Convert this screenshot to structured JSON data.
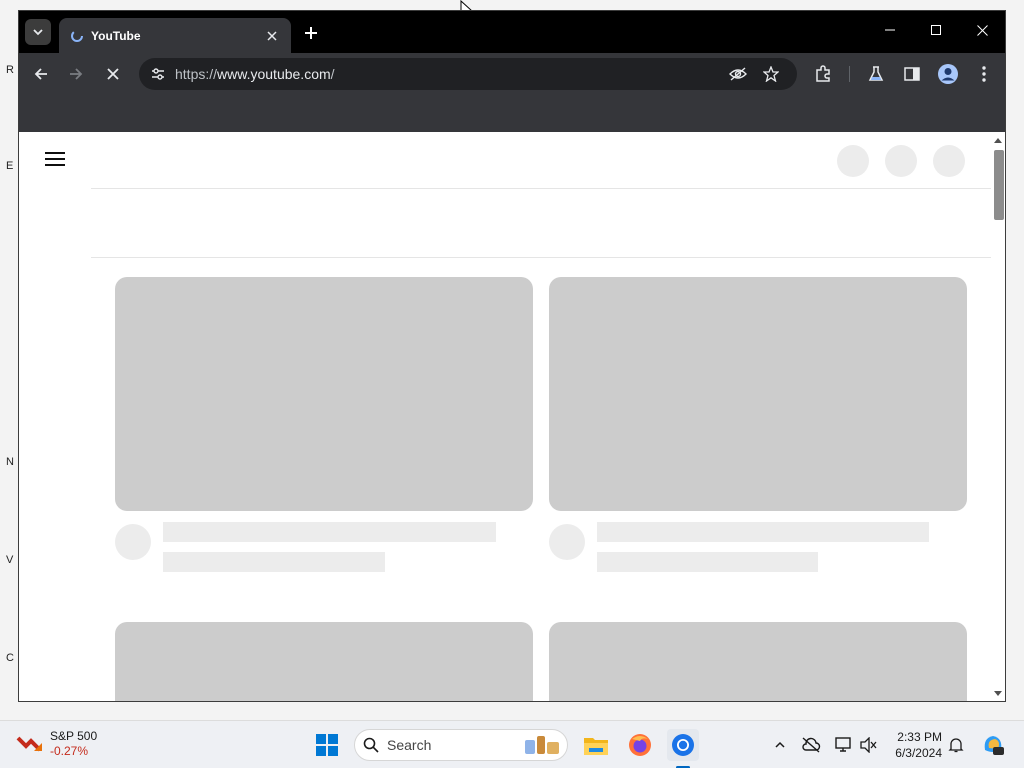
{
  "desktop": {
    "icon_letters": [
      "R",
      "E",
      "N",
      "V",
      "C"
    ]
  },
  "browser": {
    "tab": {
      "title": "YouTube"
    },
    "address": {
      "scheme": "https://",
      "host": "www.youtube.com",
      "path": "/"
    }
  },
  "taskbar": {
    "widget": {
      "name": "S&P 500",
      "change": "-0.27%"
    },
    "search_placeholder": "Search",
    "clock": {
      "time": "2:33 PM",
      "date": "6/3/2024"
    }
  },
  "colors": {
    "accent": "#0067c0",
    "negative": "#c42b1c",
    "skeleton_thumb": "#cccccc",
    "skeleton_line": "#ececec"
  }
}
